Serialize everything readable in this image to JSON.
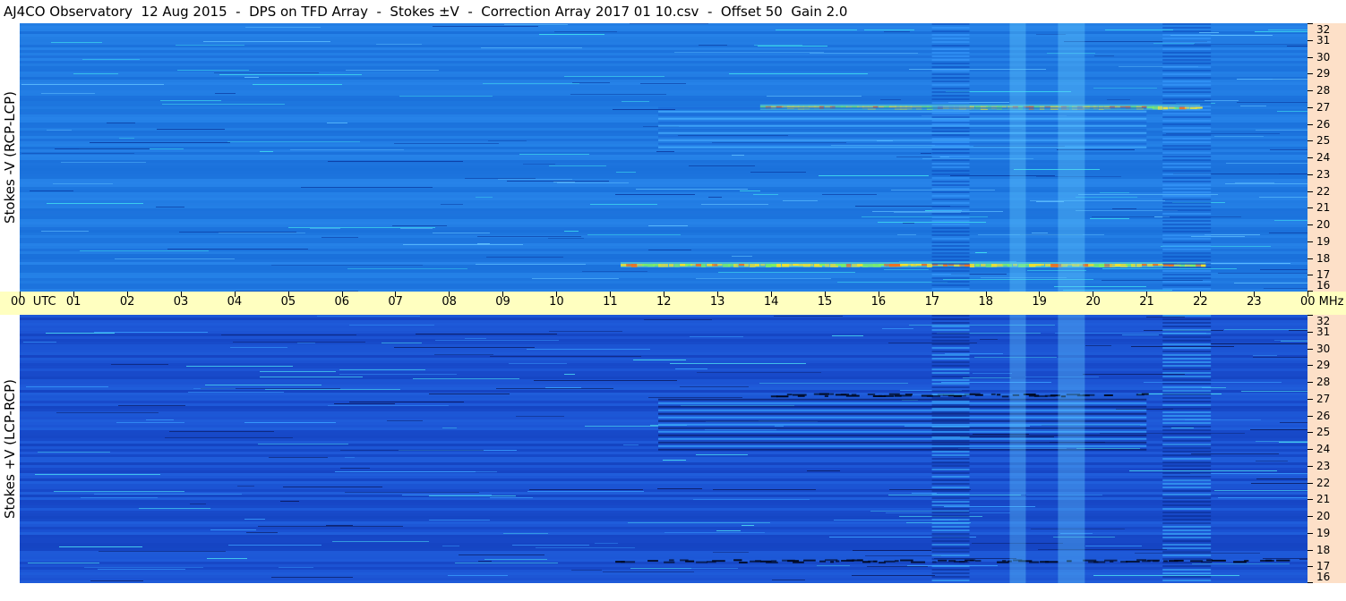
{
  "title": "AJ4CO Observatory  12 Aug 2015  -  DPS on TFD Array  -  Stokes ±V  -  Correction Array 2017 01 10.csv  -  Offset 50  Gain 2.0",
  "panels": [
    {
      "ylabel": "Stokes -V (RCP-LCP)"
    },
    {
      "ylabel": "Stokes +V (LCP-RCP)"
    }
  ],
  "freq_labels": [
    "32",
    "31",
    "30",
    "29",
    "28",
    "27",
    "26",
    "25",
    "24",
    "23",
    "22",
    "21",
    "20",
    "19",
    "18",
    "17",
    "16"
  ],
  "time_labels": [
    "00",
    "01",
    "02",
    "03",
    "04",
    "05",
    "06",
    "07",
    "08",
    "09",
    "10",
    "11",
    "12",
    "13",
    "14",
    "15",
    "16",
    "17",
    "18",
    "19",
    "20",
    "21",
    "22",
    "23",
    "00"
  ],
  "time_unit": "UTC",
  "freq_unit": "MHz",
  "colors": {
    "top_base": "#1f78e0",
    "bottom_base": "#1a4fd0",
    "axis_band": "#ffffc0",
    "right_strip": "#fde0c8"
  },
  "chart_data": {
    "type": "heatmap",
    "title": "AJ4CO Observatory  12 Aug 2015  -  DPS on TFD Array  -  Stokes ±V  -  Correction Array 2017 01 10.csv  -  Offset 50  Gain 2.0",
    "x_range_utc": [
      "00",
      "00"
    ],
    "y_range_mhz": [
      16,
      32
    ],
    "panels": [
      {
        "ylabel": "Stokes -V (RCP-LCP)",
        "features": [
          {
            "kind": "band",
            "freq_mhz": 17.6,
            "t_start": 11.2,
            "t_end": 22.1,
            "color": "#f0e030"
          },
          {
            "kind": "band",
            "freq_mhz": 27.0,
            "t_start": 13.8,
            "t_end": 22.0,
            "color": "#e8e040"
          },
          {
            "kind": "striped_block",
            "freq_from": 24.5,
            "freq_to": 27.0,
            "t_start": 11.9,
            "t_end": 21.0
          },
          {
            "kind": "vertical_glow",
            "t_center": 18.6,
            "width_h": 0.3
          },
          {
            "kind": "vertical_glow",
            "t_center": 19.6,
            "width_h": 0.5
          },
          {
            "kind": "vertical_stripe",
            "t_start": 21.3,
            "t_end": 22.2
          },
          {
            "kind": "vertical_stripe",
            "t_start": 17.0,
            "t_end": 17.7
          }
        ]
      },
      {
        "ylabel": "Stokes +V (LCP-RCP)",
        "features": [
          {
            "kind": "dark_band",
            "freq_mhz": 27.2,
            "t_start": 14.0,
            "t_end": 21.0
          },
          {
            "kind": "dark_band",
            "freq_mhz": 17.3,
            "t_start": 11.0,
            "t_end": 23.5
          },
          {
            "kind": "striped_block",
            "freq_from": 23.8,
            "freq_to": 27.0,
            "t_start": 11.9,
            "t_end": 21.0
          },
          {
            "kind": "vertical_glow",
            "t_center": 18.6,
            "width_h": 0.3
          },
          {
            "kind": "vertical_glow",
            "t_center": 19.6,
            "width_h": 0.5
          },
          {
            "kind": "vertical_stripe",
            "t_start": 21.3,
            "t_end": 22.2
          },
          {
            "kind": "vertical_stripe",
            "t_start": 17.0,
            "t_end": 17.7
          }
        ]
      }
    ]
  }
}
